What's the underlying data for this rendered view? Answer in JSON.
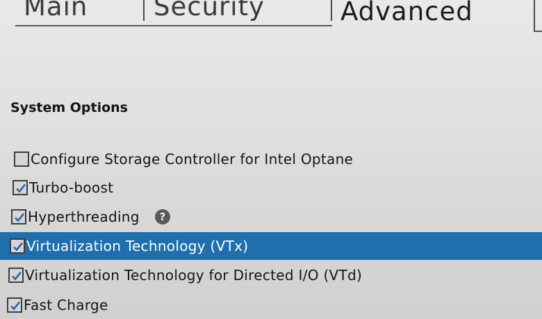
{
  "tabs": [
    {
      "label": "Main"
    },
    {
      "label": "Security"
    },
    {
      "label": "Advanced",
      "active": true
    }
  ],
  "section": {
    "title": "System Options"
  },
  "options": [
    {
      "label": "Configure Storage Controller for Intel Optane",
      "checked": false
    },
    {
      "label": "Turbo-boost",
      "checked": true
    },
    {
      "label": "Hyperthreading",
      "checked": true,
      "help_icon": "question-circle-icon",
      "help_glyph": "?"
    },
    {
      "label": "Virtualization Technology (VTx)",
      "checked": true,
      "selected": true
    },
    {
      "label": "Virtualization Technology for Directed I/O (VTd)",
      "checked": true
    },
    {
      "label": "Fast Charge",
      "checked": true
    }
  ],
  "colors": {
    "selection": "#1f6fae",
    "checkmark": "#2466a8",
    "text": "#141414"
  }
}
